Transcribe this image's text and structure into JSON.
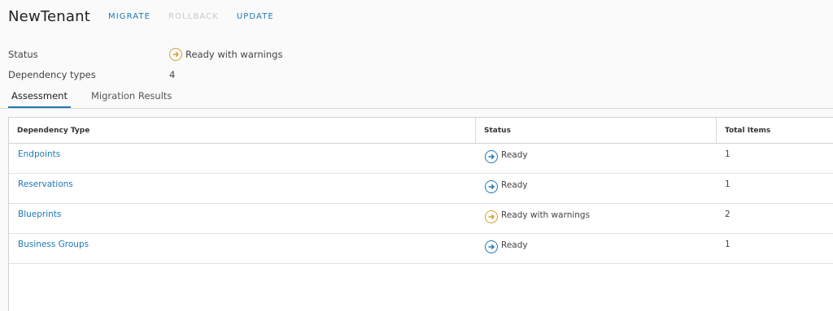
{
  "header": {
    "title": "NewTenant",
    "actions": {
      "migrate": "MIGRATE",
      "rollback": "ROLLBACK",
      "update": "UPDATE"
    }
  },
  "summary": {
    "status_label": "Status",
    "status_value": "Ready with warnings",
    "dependency_types_label": "Dependency types",
    "dependency_types_value": "4"
  },
  "tabs": [
    {
      "label": "Assessment",
      "active": true
    },
    {
      "label": "Migration Results",
      "active": false
    }
  ],
  "grid": {
    "columns": [
      "Dependency Type",
      "Status",
      "Total Items"
    ],
    "rows": [
      {
        "type": "Endpoints",
        "status": "Ready",
        "status_kind": "ok",
        "total": "1"
      },
      {
        "type": "Reservations",
        "status": "Ready",
        "status_kind": "ok",
        "total": "1"
      },
      {
        "type": "Blueprints",
        "status": "Ready with warnings",
        "status_kind": "warn",
        "total": "2"
      },
      {
        "type": "Business Groups",
        "status": "Ready",
        "status_kind": "ok",
        "total": "1"
      }
    ]
  },
  "colors": {
    "accent": "#1f78b4",
    "warning": "#d69f33",
    "disabled": "#c8c8c8"
  },
  "icons": {
    "ok": "arrow-circle-right-icon",
    "warn": "arrow-circle-right-warning-icon"
  }
}
